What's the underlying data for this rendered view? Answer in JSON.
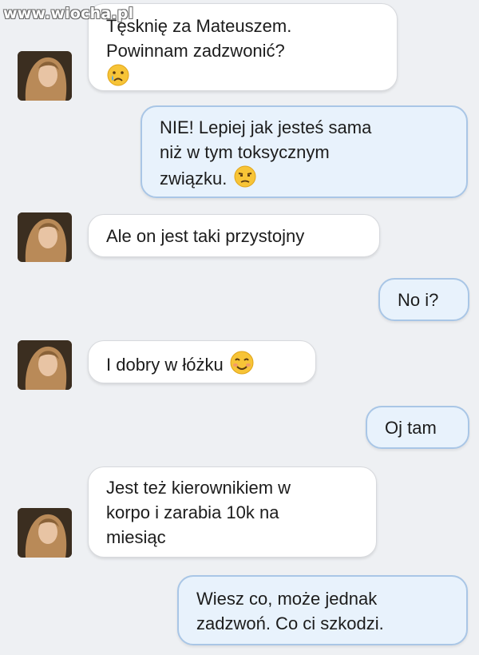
{
  "watermark": "www.wiocha.pl",
  "messages": [
    {
      "side": "incoming",
      "lines": [
        "Tęsknię za Mateuszem.",
        "Powinnam zadzwonić?"
      ],
      "emoji": "crying-face-icon"
    },
    {
      "side": "outgoing",
      "lines": [
        "NIE! Lepiej jak jesteś sama",
        "niż w tym toksycznym",
        "związku."
      ],
      "emoji": "unamused-face-icon"
    },
    {
      "side": "incoming",
      "lines": [
        "Ale on jest taki przystojny"
      ]
    },
    {
      "side": "outgoing",
      "lines": [
        "No i?"
      ]
    },
    {
      "side": "incoming",
      "lines": [
        "I dobry w łóżku"
      ],
      "emoji": "smiling-blush-face-icon"
    },
    {
      "side": "outgoing",
      "lines": [
        "Oj tam"
      ]
    },
    {
      "side": "incoming",
      "lines": [
        "Jest też kierownikiem w",
        "korpo i zarabia 10k na",
        "miesiąc"
      ]
    },
    {
      "side": "outgoing",
      "lines": [
        "Wiesz co, może jednak",
        "zadzwoń. Co ci szkodzi."
      ]
    }
  ]
}
